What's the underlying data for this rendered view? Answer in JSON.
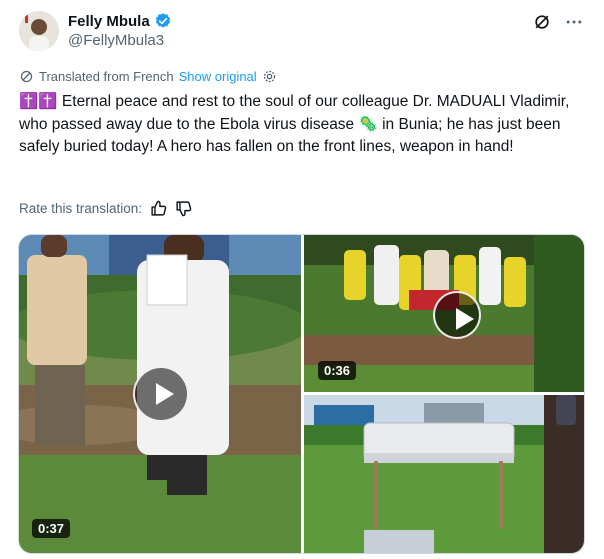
{
  "author": {
    "name": "Felly Mbula",
    "handle": "@FellyMbula3"
  },
  "translation": {
    "note": "Translated from French",
    "show_original": "Show original"
  },
  "tweet": {
    "emoji_prefix": "✝️✝️",
    "text": "Eternal peace and rest to the soul of our colleague Dr. MADUALI Vladimir, who passed away due to the Ebola virus disease 🦠 in Bunia; he has just been safely buried today! A hero has fallen on the front lines, weapon in hand!"
  },
  "rating": {
    "label": "Rate this translation:"
  },
  "media": {
    "video1_duration": "0:37",
    "video2_duration": "0:36"
  },
  "colors": {
    "accent": "#1d9bf0",
    "secondary_text": "#536471"
  }
}
